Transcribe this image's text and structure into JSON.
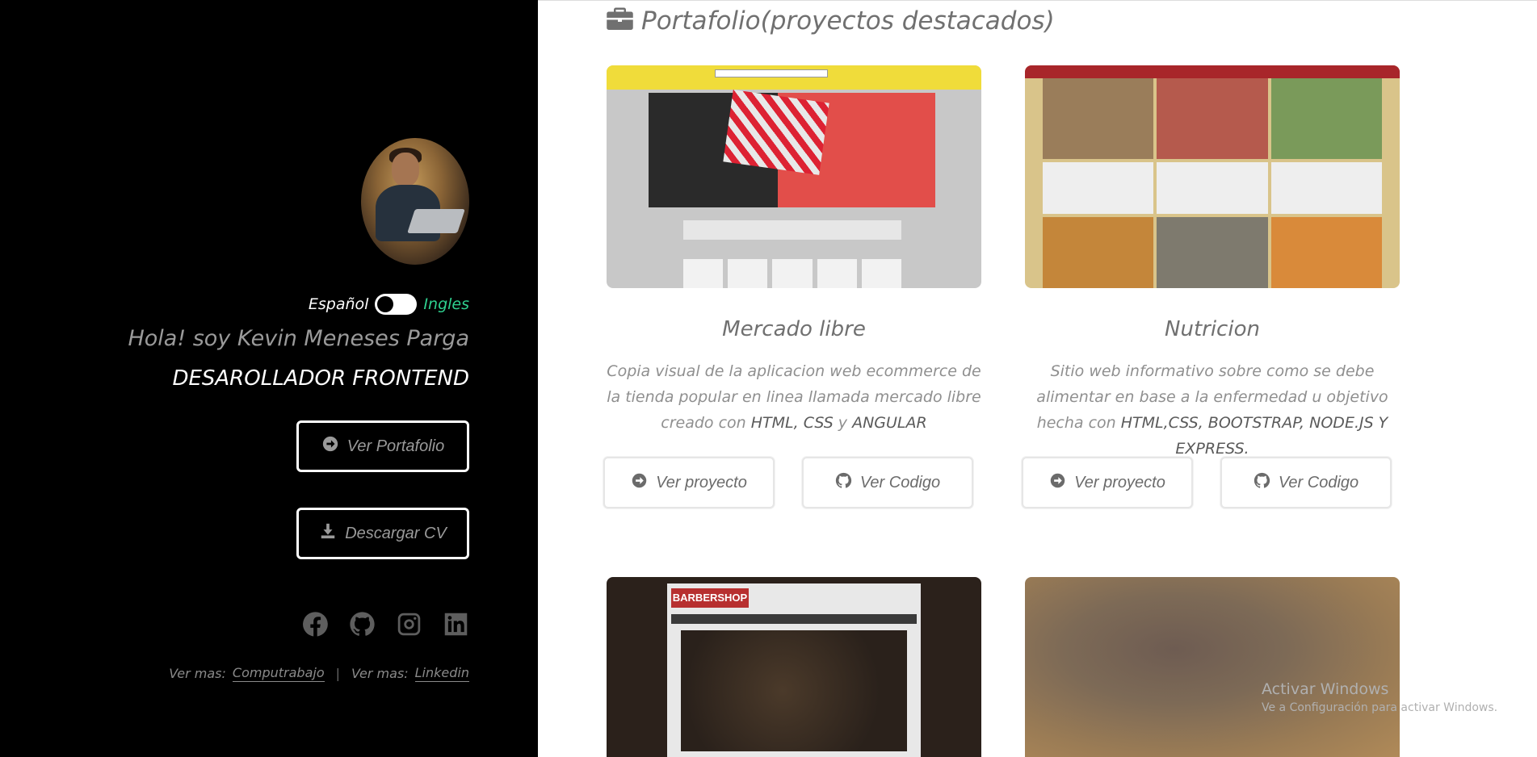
{
  "sidebar": {
    "language": {
      "left": "Español",
      "right": "Ingles"
    },
    "greeting": "Hola! soy Kevin Meneses Parga",
    "role": "DESAROLLADOR FRONTEND",
    "buttons": {
      "portfolio": "Ver Portafolio",
      "cv": "Descargar CV"
    },
    "socials": [
      "facebook-icon",
      "github-icon",
      "instagram-icon",
      "linkedin-icon"
    ],
    "more": {
      "label1": "Ver mas:",
      "link1": "Computrabajo",
      "label2": "Ver mas:",
      "link2": "Linkedin"
    }
  },
  "main": {
    "section_title": "Portafolio(proyectos destacados)",
    "projects": [
      {
        "title": "Mercado libre",
        "desc_pre": "Copia visual de la aplicacion web ecommerce de la tienda popular en linea llamada mercado libre creado con ",
        "desc_tech": "HTML, CSS",
        "desc_mid": " y ",
        "desc_tech2": "ANGULAR",
        "btn_project": "Ver proyecto",
        "btn_code": "Ver Codigo"
      },
      {
        "title": "Nutricion",
        "desc_pre": "Sitio web informativo sobre como se debe alimentar en base a la enfermedad u objetivo hecha con ",
        "desc_tech": "HTML,CSS, BOOTSTRAP, NODE.JS Y EXPRESS.",
        "btn_project": "Ver proyecto",
        "btn_code": "Ver Codigo"
      },
      {
        "thumb_logo": "BARBERSHOP"
      }
    ]
  },
  "watermark": {
    "line1": "Activar Windows",
    "line2": "Ve a Configuración para activar Windows."
  },
  "colors": {
    "sidebar_bg": "#000000",
    "accent_green": "#2fd08f",
    "text_gray": "#707070"
  }
}
